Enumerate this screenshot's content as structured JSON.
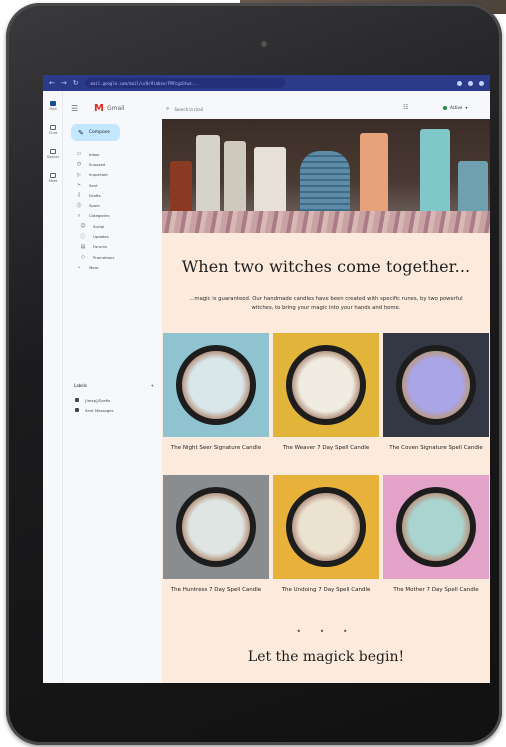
{
  "browser": {
    "url": "mail.google.com/mail/u/0/#inbox/FMfcgzGtwz..."
  },
  "gmail": {
    "app_name": "Gmail",
    "compose_label": "Compose",
    "search_placeholder": "Search in mail",
    "status_label": "Active",
    "rail": [
      {
        "label": "Mail",
        "icon": "mail-icon"
      },
      {
        "label": "Chat",
        "icon": "chat-icon"
      },
      {
        "label": "Spaces",
        "icon": "spaces-icon"
      },
      {
        "label": "Meet",
        "icon": "meet-icon"
      }
    ],
    "nav_items": [
      {
        "label": "Inbox",
        "icon": "inbox-icon"
      },
      {
        "label": "Snoozed",
        "icon": "clock-icon"
      },
      {
        "label": "Important",
        "icon": "important-icon"
      },
      {
        "label": "Sent",
        "icon": "send-icon"
      },
      {
        "label": "Drafts",
        "icon": "draft-icon"
      },
      {
        "label": "Spam",
        "icon": "spam-icon"
      },
      {
        "label": "Categories",
        "icon": "tag-icon"
      },
      {
        "label": "Social",
        "icon": "people-icon"
      },
      {
        "label": "Updates",
        "icon": "info-icon"
      },
      {
        "label": "Forums",
        "icon": "forum-icon"
      },
      {
        "label": "Promotions",
        "icon": "promo-icon"
      },
      {
        "label": "More",
        "icon": "chevron-down-icon"
      }
    ],
    "labels_heading": "Labels",
    "labels_add": "+",
    "labels": [
      "[Imap]/Drafts",
      "Sent Messages"
    ]
  },
  "email": {
    "headline": "When two witches come together...",
    "intro": "...magic is guaranteed. Our handmade candles have been created with specific runes, by two powerful witches, to bring your magic into your hands and home.",
    "products": [
      {
        "name": "The Night Seer Signature Candle",
        "bg": "#8ec3cf",
        "wax": "#d9e6ea"
      },
      {
        "name": "The Weaver 7 Day Spell Candle",
        "bg": "#e2b43a",
        "wax": "#f1ece2"
      },
      {
        "name": "The Coven Signature Spell Candle",
        "bg": "#343845",
        "wax": "#aaa5e6"
      },
      {
        "name": "The Huntress 7 Day Spell Candle",
        "bg": "#8a8d8f",
        "wax": "#dfe5e3"
      },
      {
        "name": "The Undoing 7 Day Spell Candle",
        "bg": "#e8b23a",
        "wax": "#ece2d0"
      },
      {
        "name": "The Mother 7 Day Spell Candle",
        "bg": "#e3a2c8",
        "wax": "#a9d4cf"
      }
    ],
    "separator": "• • •",
    "closing": "Let the magick begin!"
  }
}
